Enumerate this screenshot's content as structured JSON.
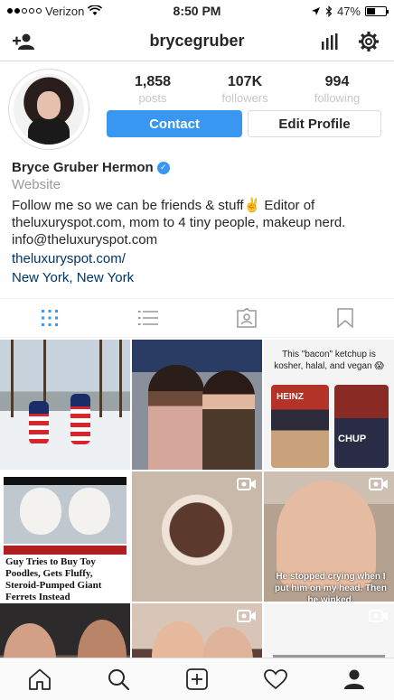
{
  "status_bar": {
    "carrier": "Verizon",
    "time": "8:50 PM",
    "battery": "47%",
    "battery_level": 0.47
  },
  "nav": {
    "username": "brycegruber",
    "left_icon": "add-person-icon",
    "right_icons": [
      "insights-icon",
      "settings-gear-icon"
    ]
  },
  "profile": {
    "stats": [
      {
        "value": "1,858",
        "label": "posts"
      },
      {
        "value": "107K",
        "label": "followers"
      },
      {
        "value": "994",
        "label": "following"
      }
    ],
    "contact_label": "Contact",
    "edit_label": "Edit Profile",
    "name": "Bryce Gruber Hermon",
    "category": "Website",
    "bio_line1": "Follow me so we can be friends & stuff✌️ Editor of",
    "bio_line2": "theluxuryspot.com, mom to 4 tiny people, makeup nerd.",
    "bio_line3": "info@theluxuryspot.com",
    "website": "theluxuryspot.com/",
    "location": "New York, New York"
  },
  "tabs": [
    "grid-icon",
    "list-icon",
    "tagged-icon",
    "saved-icon"
  ],
  "colors": {
    "accent": "#3897f0",
    "link": "#003569",
    "muted": "#999999"
  },
  "posts": {
    "p3_caption": "This \"bacon\" ketchup is kosher, halal, and vegan 😱",
    "p3_label1": "HEINZ",
    "p3_label2": "CHUP",
    "p4_caption": "Guy Tries to Buy Toy Poodles, Gets Fluffy, Steroid-Pumped Giant Ferrets Instead",
    "p6_caption": "He stopped crying when I put him on my head. Then he winked."
  },
  "bottom_nav": [
    "home-icon",
    "search-icon",
    "new-post-icon",
    "activity-heart-icon",
    "profile-icon"
  ]
}
